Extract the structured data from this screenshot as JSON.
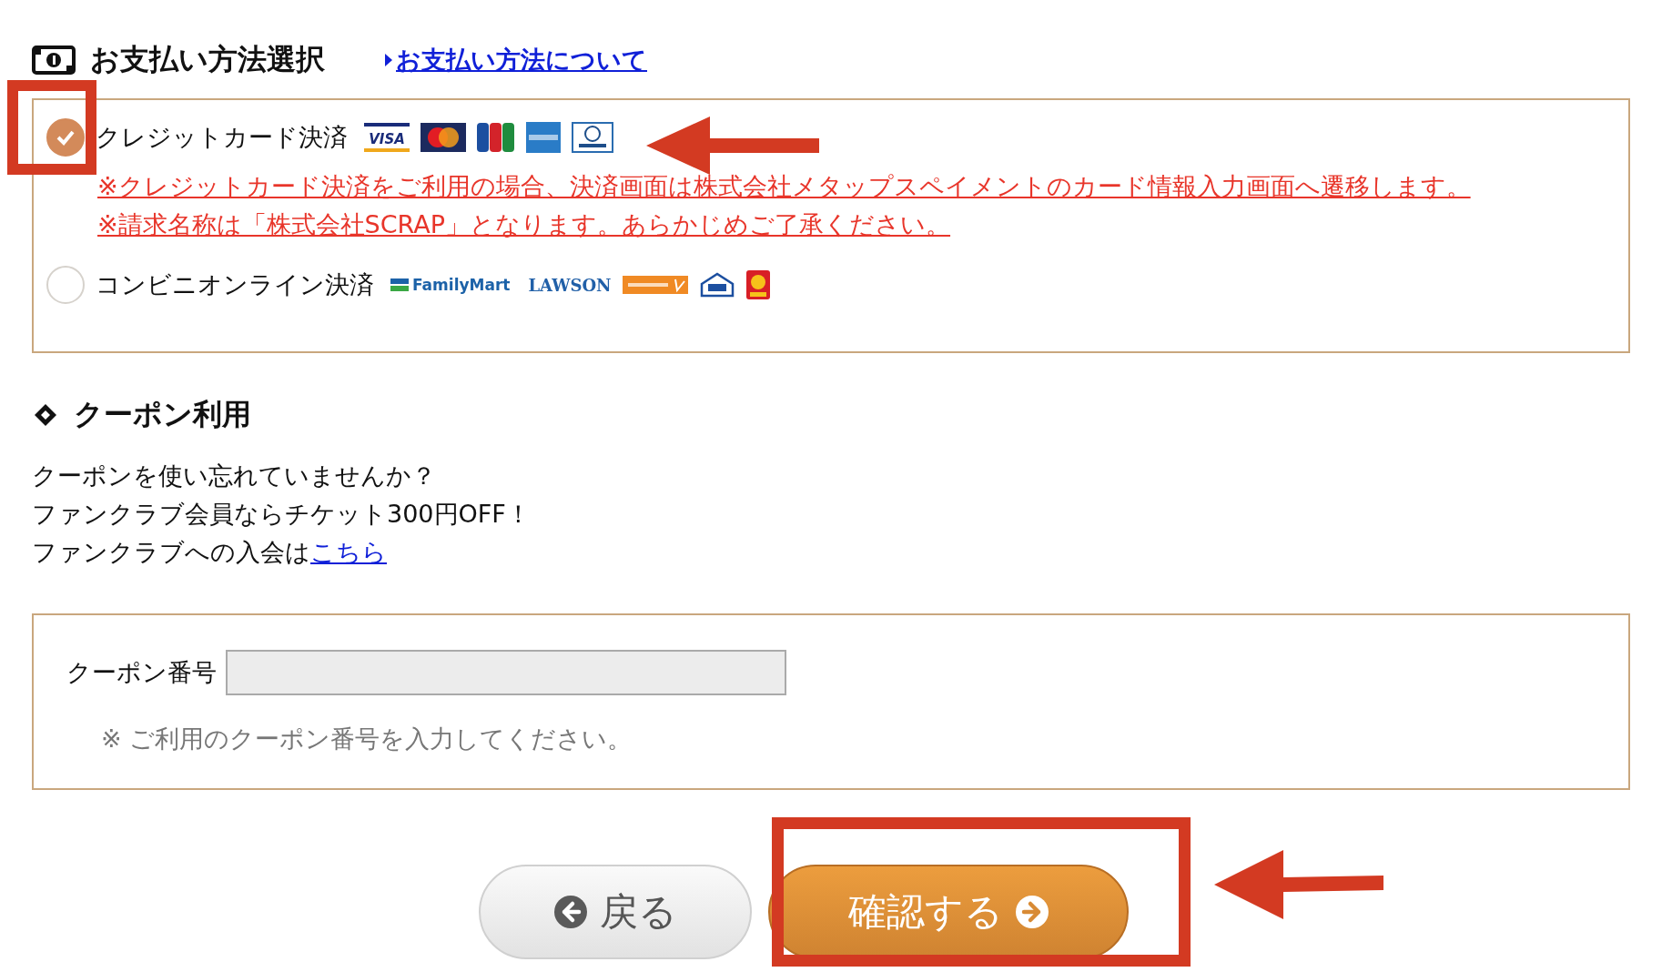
{
  "payment": {
    "title": "お支払い方法選択",
    "help_link": "お支払い方法について",
    "methods": [
      {
        "label": "クレジットカード決済",
        "selected": true,
        "logos": [
          {
            "kind": "visa",
            "text": "VISA"
          },
          {
            "kind": "mastercard"
          },
          {
            "kind": "jcb"
          },
          {
            "kind": "amex"
          },
          {
            "kind": "diners"
          }
        ],
        "notes": [
          "※クレジットカード決済をご利用の場合、決済画面は株式会社メタップスペイメントのカード情報入力画面へ遷移します。",
          "※請求名称は「株式会社SCRAP」となります。あらかじめご了承ください。"
        ]
      },
      {
        "label": "コンビニオンライン決済",
        "selected": false,
        "logos": [
          {
            "kind": "familymart",
            "text": "FamilyMart"
          },
          {
            "kind": "lawson",
            "text": "LAWSON"
          },
          {
            "kind": "seicomart"
          },
          {
            "kind": "ministop"
          },
          {
            "kind": "daily"
          }
        ]
      }
    ]
  },
  "coupon": {
    "title": "クーポン利用",
    "lines": [
      "クーポンを使い忘れていませんか？",
      "ファンクラブ会員ならチケット300円OFF！"
    ],
    "join_text": "ファンクラブへの入会は",
    "join_link": "こちら",
    "field_label": "クーポン番号",
    "field_note": "※ ご利用のクーポン番号を入力してください。"
  },
  "buttons": [
    {
      "kind": "back",
      "label": "戻る"
    },
    {
      "kind": "confirm",
      "label": "確認する"
    }
  ]
}
